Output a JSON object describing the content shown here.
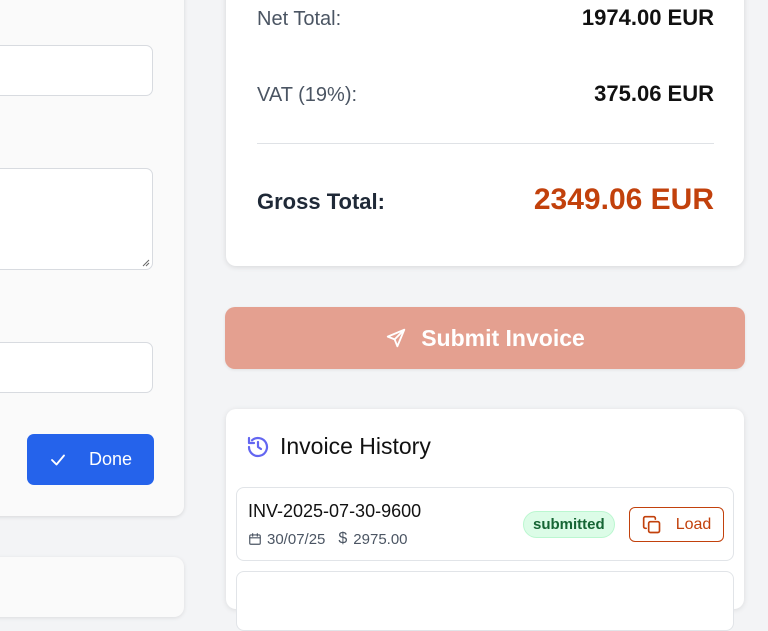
{
  "form": {
    "done_label": "Done"
  },
  "totals": {
    "net_label": "Net Total:",
    "net_value": "1974.00 EUR",
    "vat_label": "VAT (19%):",
    "vat_value": "375.06 EUR",
    "gross_label": "Gross Total:",
    "gross_value": "2349.06 EUR"
  },
  "submit": {
    "label": "Submit Invoice"
  },
  "history": {
    "title": "Invoice History",
    "items": [
      {
        "id": "INV-2025-07-30-9600",
        "date": "30/07/25",
        "amount": "2975.00",
        "status": "submitted",
        "load_label": "Load"
      }
    ]
  },
  "colors": {
    "primary": "#2563eb",
    "accent": "#c2410c",
    "submit_disabled": "#e4a090",
    "status_success_bg": "#dcfce7",
    "status_success_text": "#166534",
    "history_icon": "#6366f1"
  },
  "icons": {
    "done": "check-icon",
    "submit": "send-icon",
    "history": "history-icon",
    "date": "calendar-icon",
    "amount": "dollar-icon",
    "load": "copy-icon"
  }
}
